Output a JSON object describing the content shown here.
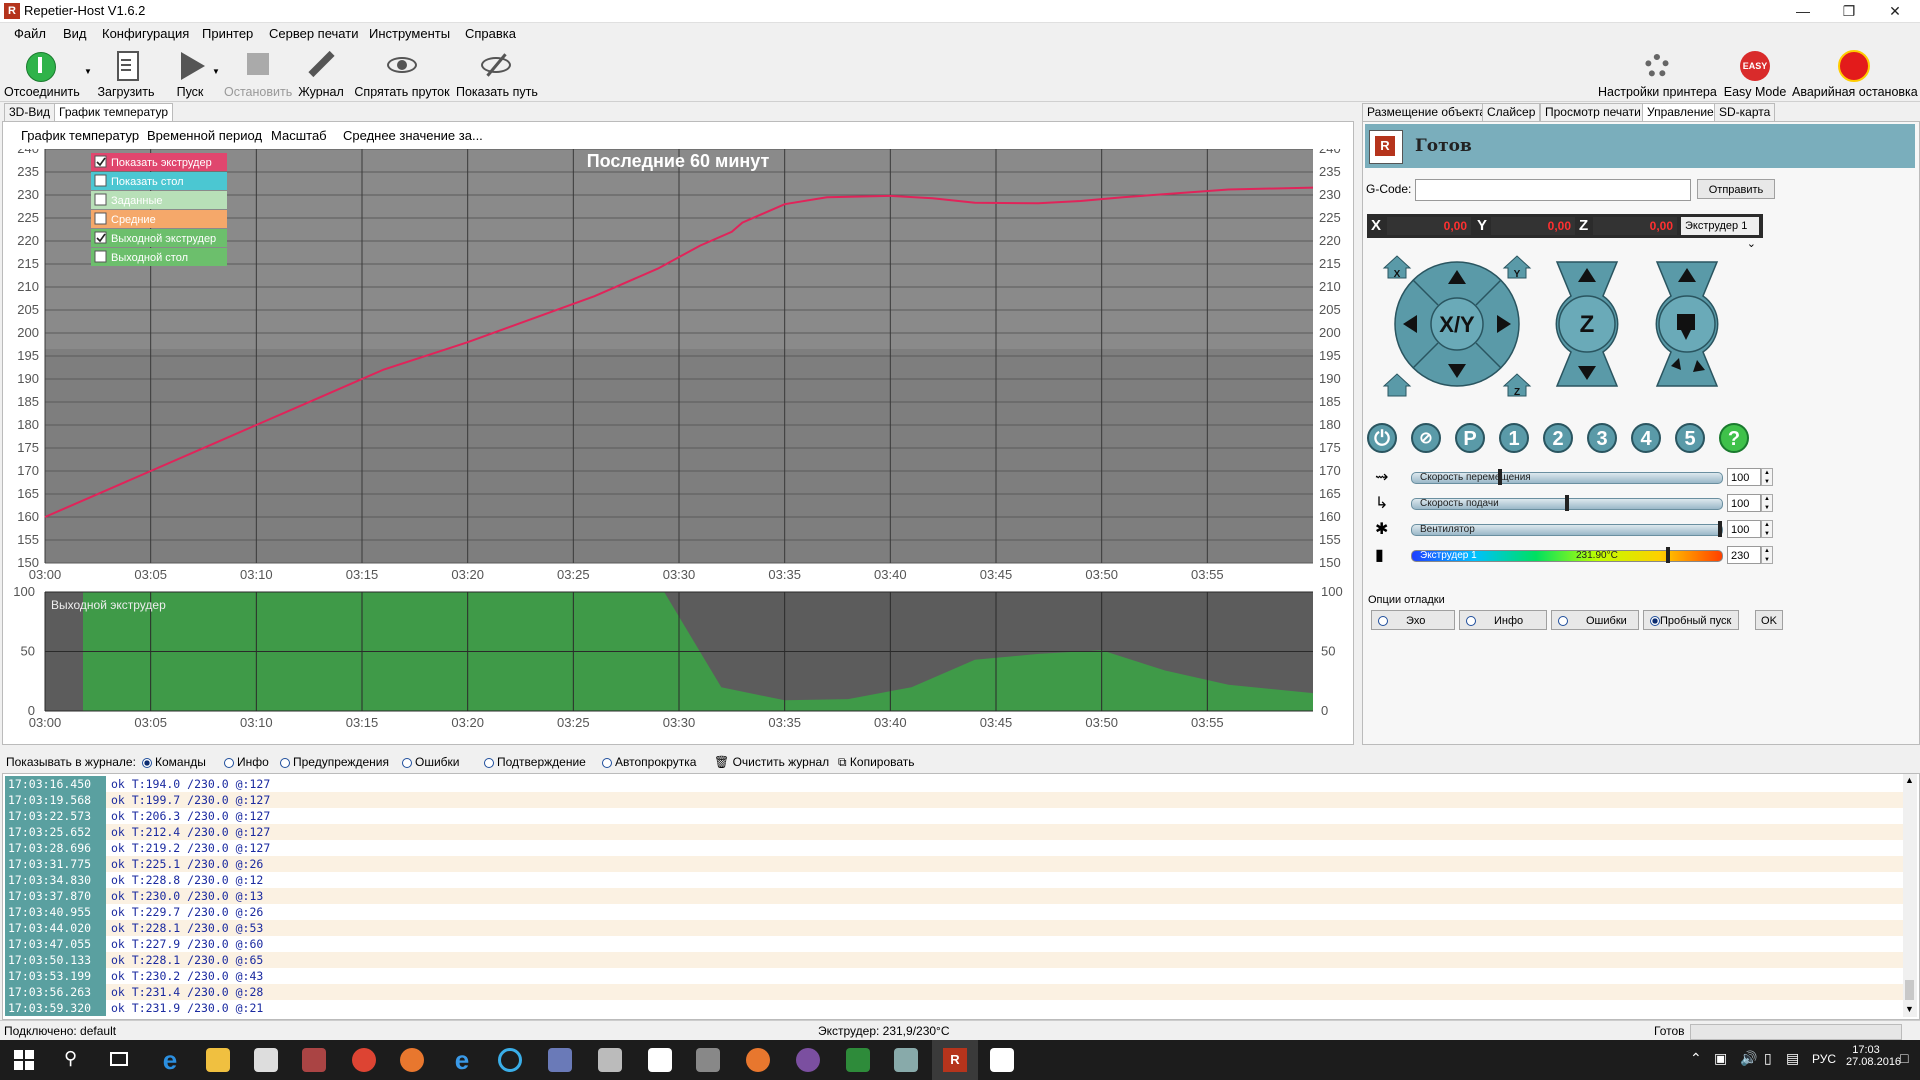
{
  "window": {
    "title": "Repetier-Host V1.6.2"
  },
  "menu": [
    "Файл",
    "Вид",
    "Конфигурация",
    "Принтер",
    "Сервер печати",
    "Инструменты",
    "Справка"
  ],
  "toolbar": {
    "left": [
      "Отсоединить",
      "Загрузить",
      "Пуск",
      "Остановить",
      "Журнал",
      "Спрятать пруток",
      "Показать путь"
    ],
    "right": [
      "Настройки принтера",
      "Easy Mode",
      "Аварийная остановка"
    ],
    "easy_badge": "EASY"
  },
  "left_tabs": [
    "3D-Вид",
    "График температур"
  ],
  "chart_subtabs": [
    "График температур",
    "Временной период",
    "Масштаб",
    "Среднее значение за..."
  ],
  "right_tabs": [
    "Размещение объекта",
    "Слайсер",
    "Просмотр печати",
    "Управление",
    "SD-карта"
  ],
  "legend": [
    {
      "label": "Показать экструдер",
      "checked": true,
      "color": "#e0466e"
    },
    {
      "label": "Показать стол",
      "checked": false,
      "color": "#4bc7d2"
    },
    {
      "label": "Заданные",
      "checked": false,
      "color": "#b8e0b8"
    },
    {
      "label": "Средние",
      "checked": false,
      "color": "#f5a86a"
    },
    {
      "label": "Выходной экструдер",
      "checked": true,
      "color": "#6cbf6c"
    },
    {
      "label": "Выходной стол",
      "checked": false,
      "color": "#6cbf6c"
    }
  ],
  "chart_data": [
    {
      "type": "line",
      "title": "Последние 60 минут",
      "x": [
        "03:00",
        "03:05",
        "03:10",
        "03:15",
        "03:20",
        "03:25",
        "03:30",
        "03:35",
        "03:40",
        "03:45",
        "03:50",
        "03:55"
      ],
      "y_ticks": [
        150,
        155,
        160,
        165,
        170,
        175,
        180,
        185,
        190,
        195,
        200,
        205,
        210,
        215,
        220,
        225,
        230,
        235,
        240
      ],
      "ylim": [
        150,
        240
      ],
      "series": [
        {
          "name": "Показать экструдер",
          "color": "#e0245a",
          "points": [
            [
              0,
              160
            ],
            [
              1,
              162
            ],
            [
              3,
              166
            ],
            [
              5,
              170
            ],
            [
              8,
              176
            ],
            [
              10,
              180
            ],
            [
              13,
              186
            ],
            [
              16,
              192
            ],
            [
              20,
              198
            ],
            [
              23,
              203
            ],
            [
              26,
              208
            ],
            [
              29,
              214
            ],
            [
              31,
              219
            ],
            [
              32.5,
              222
            ],
            [
              33,
              224
            ],
            [
              34,
              226
            ],
            [
              35,
              228
            ],
            [
              37,
              229.5
            ],
            [
              40,
              229.8
            ],
            [
              42,
              229.3
            ],
            [
              44,
              228.3
            ],
            [
              47,
              228.2
            ],
            [
              49,
              228.7
            ],
            [
              51,
              229.5
            ],
            [
              53,
              230.2
            ],
            [
              56,
              231.2
            ],
            [
              60,
              231.6
            ]
          ]
        }
      ]
    },
    {
      "type": "area",
      "title": "Выходной экструдер",
      "x": [
        "03:00",
        "03:05",
        "03:10",
        "03:15",
        "03:20",
        "03:25",
        "03:30",
        "03:35",
        "03:40",
        "03:45",
        "03:50",
        "03:55"
      ],
      "y_ticks": [
        0,
        50,
        100
      ],
      "ylim": [
        0,
        100
      ],
      "series": [
        {
          "name": "Выходной экструдер",
          "color": "#3f9a48",
          "points": [
            [
              0,
              0
            ],
            [
              1.8,
              0
            ],
            [
              1.8,
              100
            ],
            [
              29.3,
              100
            ],
            [
              32,
              20
            ],
            [
              35,
              9
            ],
            [
              38,
              10
            ],
            [
              41,
              20
            ],
            [
              44,
              43
            ],
            [
              47,
              48
            ],
            [
              50,
              51
            ],
            [
              53,
              34
            ],
            [
              56,
              22
            ],
            [
              60,
              15
            ]
          ]
        }
      ]
    }
  ],
  "control": {
    "status": "Готов",
    "gcode_label": "G-Code:",
    "gcode_value": "",
    "send_label": "Отправить",
    "x_label": "X",
    "x_val": "0,00",
    "y_label": "Y",
    "y_val": "0,00",
    "z_label": "Z",
    "z_val": "0,00",
    "extruder_select": "Экструдер 1",
    "xy_label": "X/Y",
    "z_btn": "Z",
    "home_x": "X",
    "home_y": "Y",
    "home_z": "Z",
    "buttons_row": [
      "P",
      "1",
      "2",
      "3",
      "4",
      "5",
      "?"
    ],
    "sliders": [
      {
        "label": "Скорость перемещения",
        "value": "100",
        "level": 0.28
      },
      {
        "label": "Скорость подачи",
        "value": "100",
        "level": 0.5
      },
      {
        "label": "Вентилятор",
        "value": "100",
        "level": 1.0
      },
      {
        "label": "Экструдер 1",
        "value": "230",
        "mid": "231.90°C",
        "level": 0.83
      }
    ],
    "debug_title": "Опции отладки",
    "debug_options": [
      "Эхо",
      "Инфо",
      "Ошибки",
      "Пробный пуск"
    ],
    "ok_label": "OK"
  },
  "log": {
    "show_label": "Показывать в журнале:",
    "options": [
      {
        "label": "Команды",
        "on": true
      },
      {
        "label": "Инфо",
        "on": false
      },
      {
        "label": "Предупреждения",
        "on": false
      },
      {
        "label": "Ошибки",
        "on": false
      },
      {
        "label": "Подтверждение",
        "on": false
      },
      {
        "label": "Автопрокрутка",
        "on": false
      }
    ],
    "clear_label": "Очистить журнал",
    "copy_label": "Копировать",
    "rows": [
      {
        "t": "17:03:16.450",
        "m": "ok T:194.0 /230.0 @:127"
      },
      {
        "t": "17:03:19.568",
        "m": "ok T:199.7 /230.0 @:127"
      },
      {
        "t": "17:03:22.573",
        "m": "ok T:206.3 /230.0 @:127"
      },
      {
        "t": "17:03:25.652",
        "m": "ok T:212.4 /230.0 @:127"
      },
      {
        "t": "17:03:28.696",
        "m": "ok T:219.2 /230.0 @:127"
      },
      {
        "t": "17:03:31.775",
        "m": "ok T:225.1 /230.0 @:26"
      },
      {
        "t": "17:03:34.830",
        "m": "ok T:228.8 /230.0 @:12"
      },
      {
        "t": "17:03:37.870",
        "m": "ok T:230.0 /230.0 @:13"
      },
      {
        "t": "17:03:40.955",
        "m": "ok T:229.7 /230.0 @:26"
      },
      {
        "t": "17:03:44.020",
        "m": "ok T:228.1 /230.0 @:53"
      },
      {
        "t": "17:03:47.055",
        "m": "ok T:227.9 /230.0 @:60"
      },
      {
        "t": "17:03:50.133",
        "m": "ok T:228.1 /230.0 @:65"
      },
      {
        "t": "17:03:53.199",
        "m": "ok T:230.2 /230.0 @:43"
      },
      {
        "t": "17:03:56.263",
        "m": "ok T:231.4 /230.0 @:28"
      },
      {
        "t": "17:03:59.320",
        "m": "ok T:231.9 /230.0 @:21"
      }
    ]
  },
  "status": {
    "connected": "Подключено: default",
    "extruder": "Экструдер: 231,9/230°C",
    "ready": "Готов"
  },
  "taskbar": {
    "lang": "РУС",
    "time": "17:03",
    "date": "27.08.2016"
  }
}
